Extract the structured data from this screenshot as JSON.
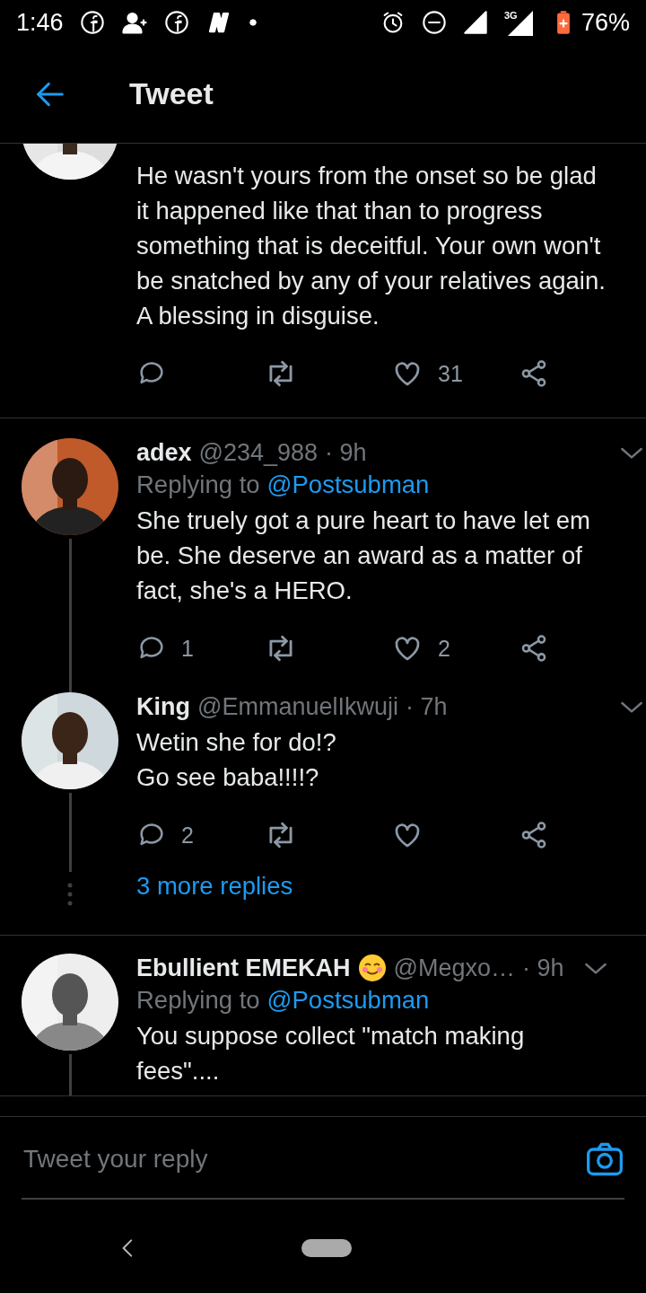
{
  "status_bar": {
    "time": "1:46",
    "battery": "76%",
    "network": "3G"
  },
  "header": {
    "title": "Tweet"
  },
  "tweets": [
    {
      "partial": true,
      "threaded": false,
      "text": "He wasn't yours from the onset so be glad it happened like that than to progress something that is deceitful. Your own won't be snatched by any of your relatives again. A blessing in disguise.",
      "likes": "31"
    },
    {
      "partial": false,
      "threaded": true,
      "name": "adex",
      "handle": "@234_988",
      "time": "· 9h",
      "replying_label": "Replying to",
      "replying_to": "@Postsubman",
      "text": "She truely got a pure heart to have let em be. She deserve an award as a matter of fact, she's a HERO.",
      "replies": "1",
      "likes": "2"
    },
    {
      "partial": false,
      "threaded": true,
      "name": "King",
      "handle": "@EmmanuelIkwuji",
      "time": "· 7h",
      "text": "Wetin she for do!?\nGo see baba!!!!?",
      "replies": "2",
      "more_replies": "3 more replies"
    },
    {
      "partial": false,
      "threaded": true,
      "name": "Ebullient EMEKAH",
      "emoji": true,
      "handle": "@Megxo…",
      "time": "· 9h",
      "replying_label": "Replying to",
      "replying_to": "@Postsubman",
      "text": "You suppose collect \"match making fees\"...."
    }
  ],
  "reply_bar": {
    "placeholder": "Tweet your reply"
  }
}
